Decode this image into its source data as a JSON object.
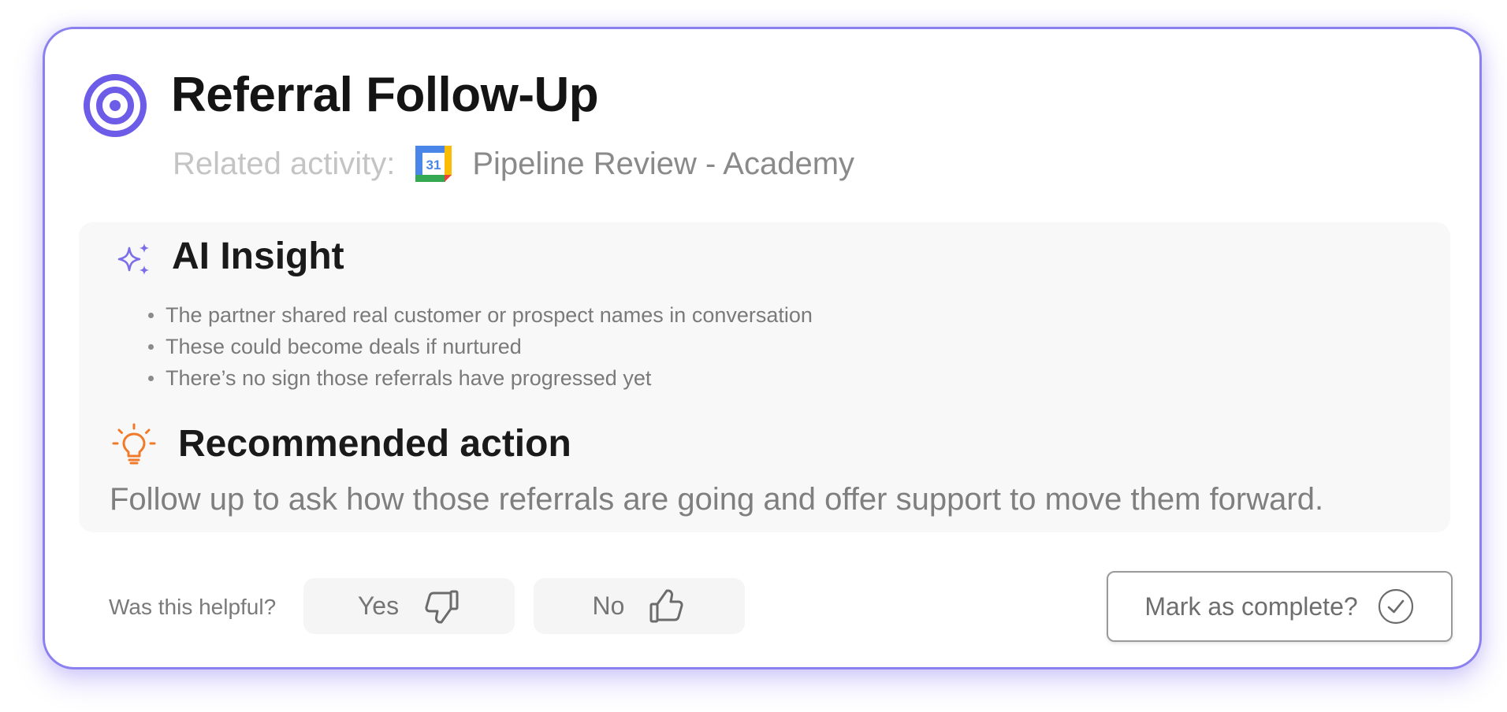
{
  "card": {
    "title": "Referral Follow-Up",
    "title_icon": "target-icon",
    "related_label": "Related activity:",
    "related_icon": "google-calendar-icon",
    "related_icon_day": "31",
    "related_activity": "Pipeline Review - Academy"
  },
  "insight": {
    "icon": "sparkle-icon",
    "title": "AI Insight",
    "bullets": [
      "The partner shared real customer or prospect names in conversation",
      "These could become deals if nurtured",
      "There’s no sign those referrals have progressed yet"
    ]
  },
  "recommendation": {
    "icon": "lightbulb-icon",
    "title": "Recommended action",
    "text": "Follow up to ask how those referrals are going and offer support to move them forward."
  },
  "feedback": {
    "question": "Was this helpful?",
    "yes_label": "Yes",
    "yes_icon": "thumbs-down-icon",
    "no_label": "No",
    "no_icon": "thumbs-up-icon"
  },
  "complete": {
    "label": "Mark as complete?",
    "icon": "check-circle-icon"
  },
  "colors": {
    "accent": "#6c5ce7",
    "card_border": "#8b80f0",
    "bulb": "#f07a2a",
    "panel_bg": "#f8f8f8"
  }
}
